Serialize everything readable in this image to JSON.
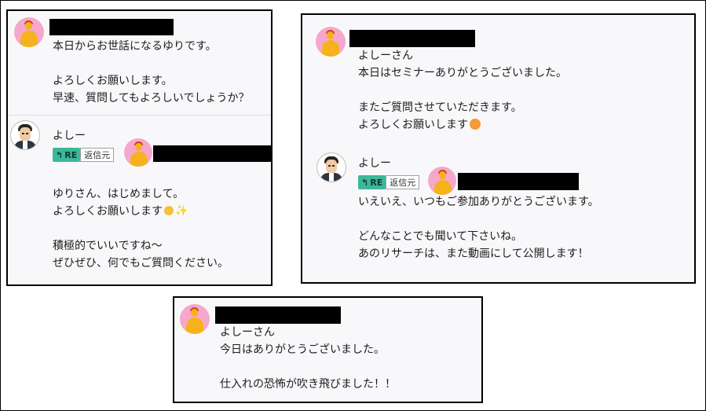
{
  "panel1": {
    "post1": {
      "lines": [
        "本日からお世話になるゆりです。",
        "",
        "よろしくお願いします。",
        "早速、質問してもよろしいでしょうか？"
      ]
    },
    "post2": {
      "name": "よしー",
      "re_badge": "RE",
      "re_orig": "返信元",
      "lines": [
        "ゆりさん、はじめまして。",
        "よろしくお願いします",
        "",
        "積極的でいいですね〜",
        "ぜひぜひ、何でもご質問ください。"
      ],
      "emojis": [
        "smile-emoji",
        "sparkles-emoji"
      ]
    }
  },
  "panel2": {
    "post1": {
      "lines": [
        "よしーさん",
        "本日はセミナーありがとうございました。",
        "",
        "またご質問させていただきます。",
        "よろしくお願いします"
      ],
      "emojis": [
        "smiling-face-with-hearts-emoji"
      ]
    },
    "post2": {
      "name": "よしー",
      "re_badge": "RE",
      "re_orig": "返信元",
      "lines": [
        "いえいえ、いつもご参加ありがとうございます。",
        "",
        "どんなことでも聞いて下さいね。",
        "あのリサーチは、また動画にして公開します！"
      ]
    }
  },
  "panel3": {
    "post1": {
      "lines": [
        "よしーさん",
        "今日はありがとうございました。",
        "",
        "仕入れの恐怖が吹き飛びました！！"
      ]
    }
  },
  "colors": {
    "re_badge": "#3db79a",
    "yuri_avatar_bg": "#f5a8cc",
    "redaction": "#000000"
  }
}
